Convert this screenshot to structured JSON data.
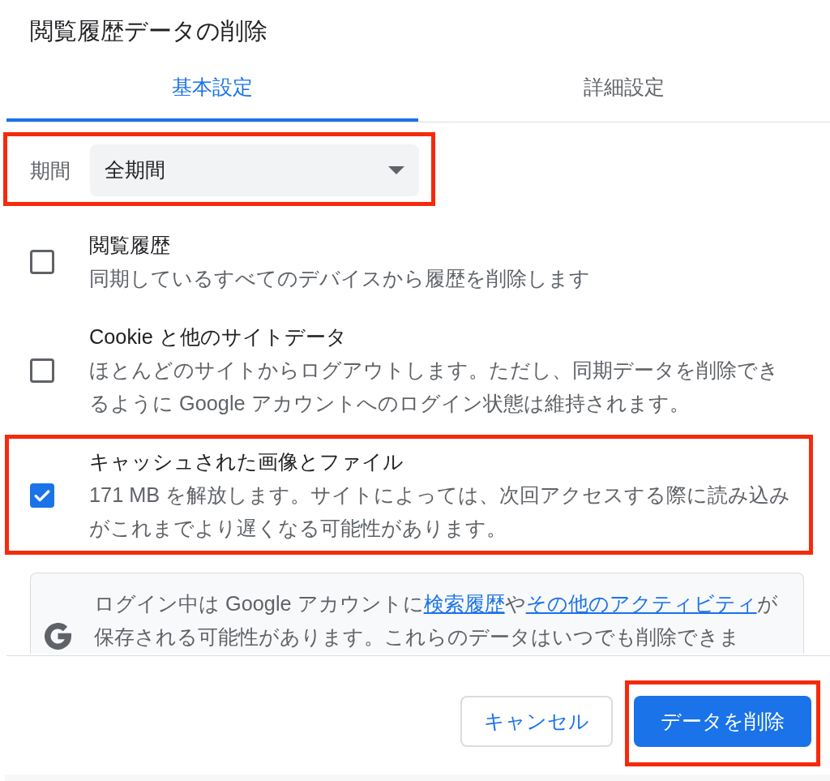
{
  "dialog": {
    "title": "閲覧履歴データの削除"
  },
  "tabs": [
    {
      "label": "基本設定",
      "selected": true
    },
    {
      "label": "詳細設定",
      "selected": false
    }
  ],
  "time_range": {
    "label": "期間",
    "value": "全期間",
    "highlighted": true
  },
  "options": [
    {
      "title": "閲覧履歴",
      "description": "同期しているすべてのデバイスから履歴を削除します",
      "checked": false,
      "highlighted": false
    },
    {
      "title": "Cookie と他のサイトデータ",
      "description": "ほとんどのサイトからログアウトします。ただし、同期データを削除できるように Google アカウントへのログイン状態は維持されます。",
      "checked": false,
      "highlighted": false
    },
    {
      "title": "キャッシュされた画像とファイル",
      "description": "171 MB を解放します。サイトによっては、次回アクセスする際に読み込みがこれまでより遅くなる可能性があります。",
      "checked": true,
      "highlighted": true
    }
  ],
  "info": {
    "segments": [
      {
        "kind": "text",
        "text": "ログイン中は Google アカウントに"
      },
      {
        "kind": "link",
        "text": "検索履歴"
      },
      {
        "kind": "text",
        "text": "や"
      },
      {
        "kind": "link",
        "text": "その他のアクティビティ"
      },
      {
        "kind": "text",
        "text": "が保存される可能性があります。これらのデータはいつでも削除できま"
      }
    ]
  },
  "buttons": [
    {
      "label": "キャンセル",
      "kind": "secondary",
      "highlighted": false
    },
    {
      "label": "データを削除",
      "kind": "primary",
      "highlighted": true
    }
  ]
}
